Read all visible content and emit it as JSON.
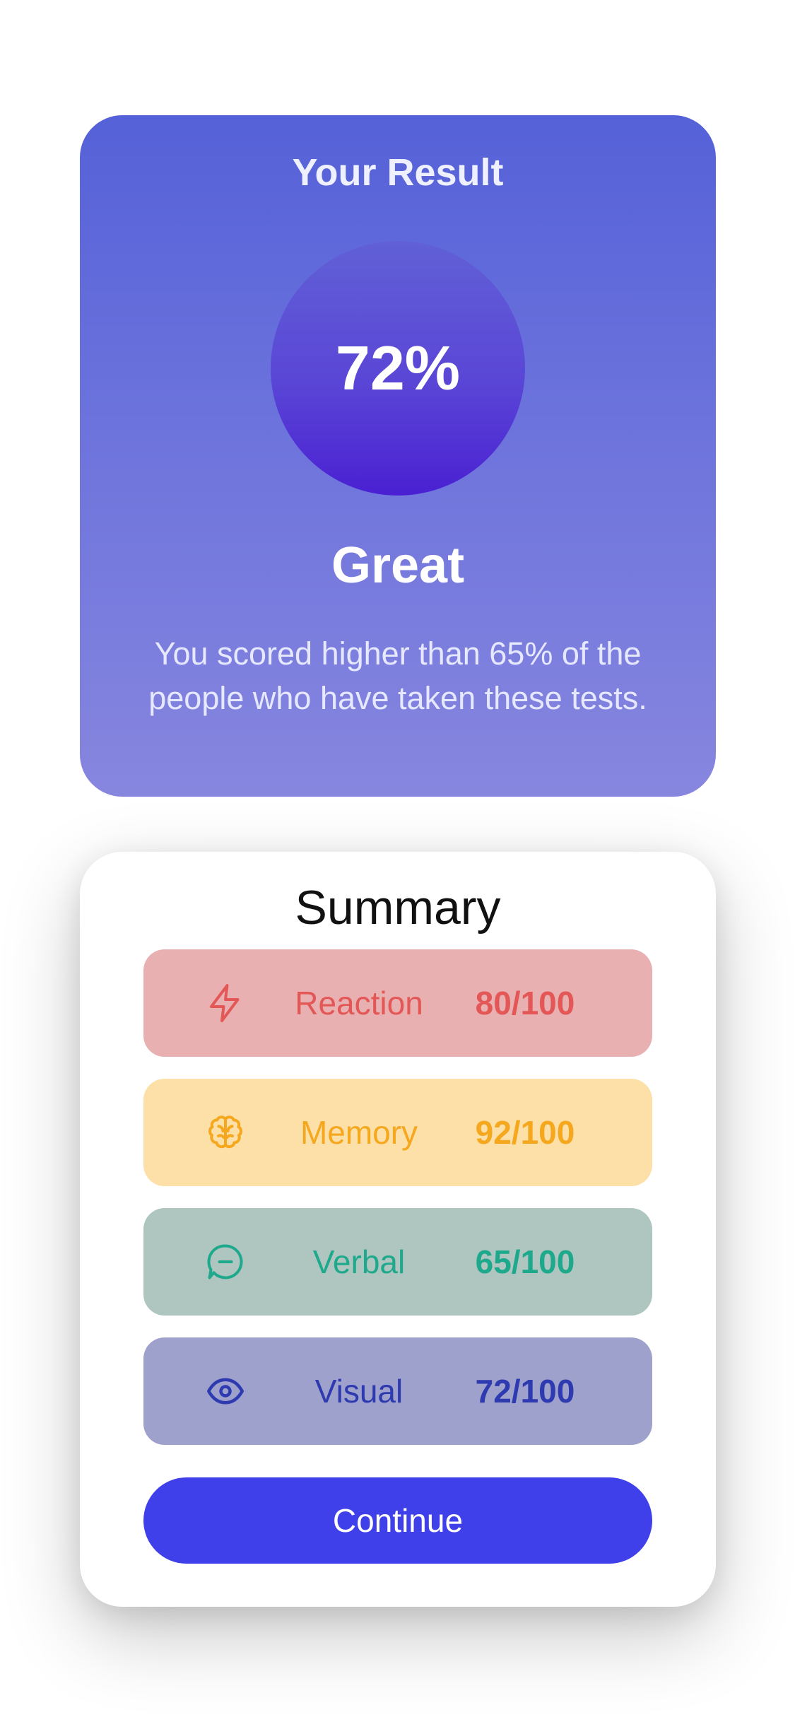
{
  "result": {
    "title": "Your Result",
    "score": "72%",
    "rating": "Great",
    "description": "You scored higher than 65% of the people who have taken these tests."
  },
  "summary": {
    "title": "Summary",
    "items": [
      {
        "icon": "lightning-icon",
        "label": "Reaction",
        "score": "80/100",
        "color": "#e35757",
        "bg": "#e8b0b1"
      },
      {
        "icon": "brain-icon",
        "label": "Memory",
        "score": "92/100",
        "color": "#f5a81e",
        "bg": "#fddfa8"
      },
      {
        "icon": "chat-bubble-icon",
        "label": "Verbal",
        "score": "65/100",
        "color": "#1ea98c",
        "bg": "#aec6bf"
      },
      {
        "icon": "eye-icon",
        "label": "Visual",
        "score": "72/100",
        "color": "#2e3ab0",
        "bg": "#9ea1cb"
      }
    ],
    "continue_label": "Continue"
  },
  "colors": {
    "accent": "#4040eb",
    "result_gradient_top": "#5561d8",
    "result_gradient_bottom": "#8786df"
  }
}
